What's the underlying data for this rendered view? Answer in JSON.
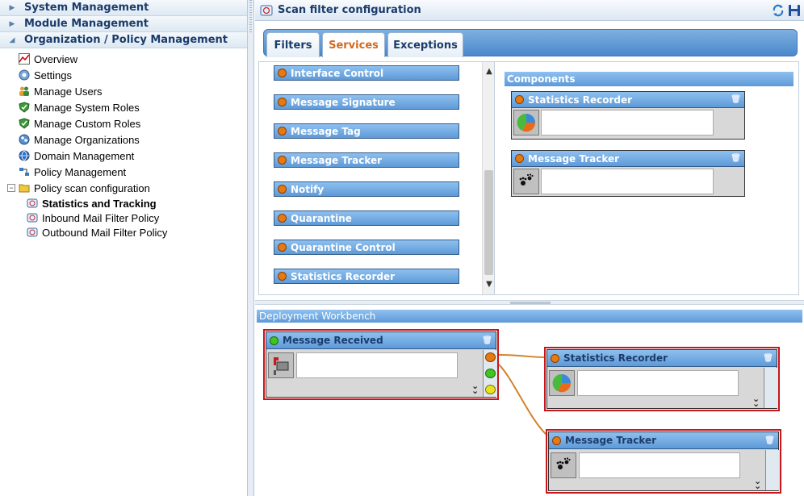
{
  "sidebar": {
    "sections": [
      {
        "label": "System Management"
      },
      {
        "label": "Module Management"
      },
      {
        "label": "Organization / Policy Management"
      }
    ],
    "tree": [
      {
        "label": "Overview",
        "icon": "chart-icon"
      },
      {
        "label": "Settings",
        "icon": "settings-icon"
      },
      {
        "label": "Manage Users",
        "icon": "users-icon"
      },
      {
        "label": "Manage System Roles",
        "icon": "shield-icon"
      },
      {
        "label": "Manage Custom Roles",
        "icon": "shield-icon"
      },
      {
        "label": "Manage Organizations",
        "icon": "organizations-icon"
      },
      {
        "label": "Domain Management",
        "icon": "globe-icon"
      },
      {
        "label": "Policy Management",
        "icon": "policy-icon"
      },
      {
        "label": "Policy scan configuration",
        "icon": "folder-icon"
      },
      {
        "label": "Statistics and Tracking",
        "icon": "scan-icon"
      },
      {
        "label": "Inbound Mail Filter Policy",
        "icon": "scan-icon"
      },
      {
        "label": "Outbound Mail Filter Policy",
        "icon": "scan-icon"
      }
    ]
  },
  "main": {
    "title": "Scan filter configuration",
    "tabs": [
      {
        "label": "Filters"
      },
      {
        "label": "Services"
      },
      {
        "label": "Exceptions"
      }
    ],
    "active_tab": "Services",
    "services": [
      "Interface Control",
      "Message Signature",
      "Message Tag",
      "Message Tracker",
      "Notify",
      "Quarantine",
      "Quarantine Control",
      "Statistics Recorder"
    ],
    "components_title": "Components",
    "components": [
      {
        "label": "Statistics Recorder",
        "icon": "pie-chart-icon"
      },
      {
        "label": "Message Tracker",
        "icon": "paw-prints-icon"
      }
    ],
    "workbench": {
      "title": "Deployment Workbench",
      "nodes": [
        {
          "label": "Message Received",
          "icon": "mailbox-icon"
        },
        {
          "label": "Statistics Recorder",
          "icon": "pie-chart-icon"
        },
        {
          "label": "Message Tracker",
          "icon": "paw-prints-icon"
        }
      ]
    }
  },
  "colors": {
    "accent_blue": "#5e9ad8",
    "active_tab": "#d2691e",
    "selection_red": "#c8151b",
    "connector": "#d2832a"
  }
}
